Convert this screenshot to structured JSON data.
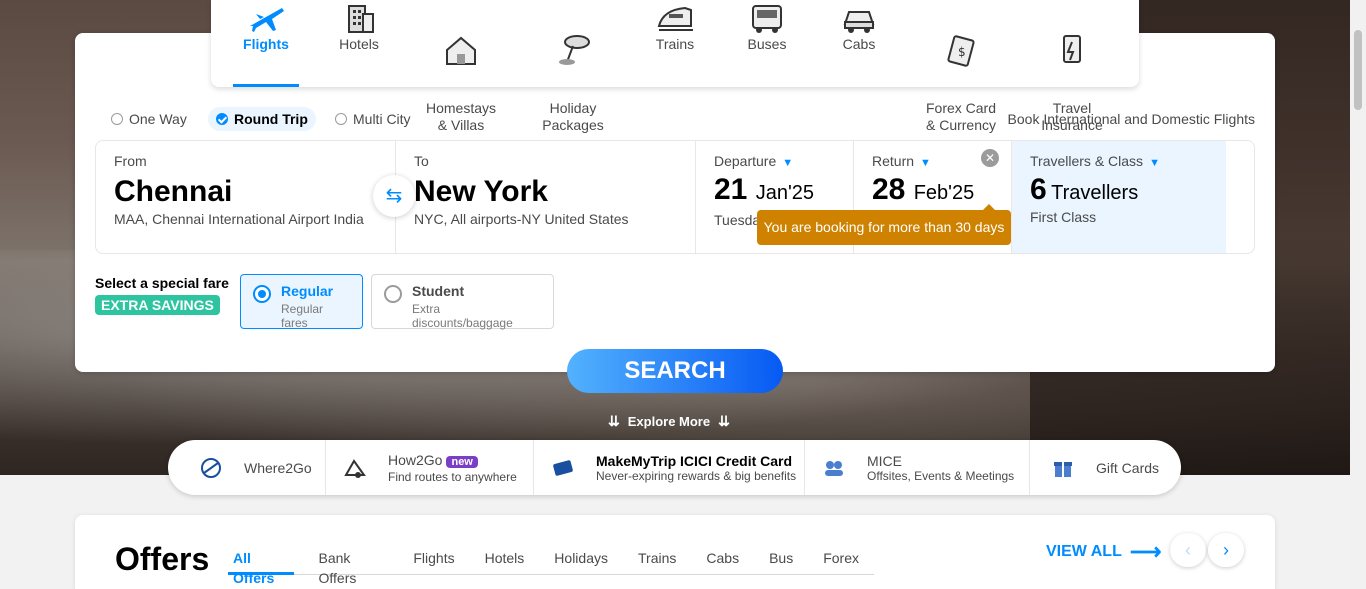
{
  "nav": {
    "items": [
      {
        "label": "Flights",
        "icon": "plane-icon",
        "active": true
      },
      {
        "label": "Hotels",
        "icon": "hotel-icon"
      },
      {
        "label": "Homestays\n& Villas",
        "icon": "homestay-icon"
      },
      {
        "label": "Holiday\nPackages",
        "icon": "holiday-icon"
      },
      {
        "label": "Trains",
        "icon": "train-icon"
      },
      {
        "label": "Buses",
        "icon": "bus-icon"
      },
      {
        "label": "Cabs",
        "icon": "cab-icon"
      },
      {
        "label": "Forex Card\n& Currency",
        "icon": "forex-icon"
      },
      {
        "label": "Travel\nInsurance",
        "icon": "insurance-icon"
      }
    ]
  },
  "trip": {
    "one_way": "One Way",
    "round_trip": "Round Trip",
    "multi_city": "Multi City",
    "tagline": "Book International and Domestic Flights"
  },
  "search": {
    "from_label": "From",
    "from_city": "Chennai",
    "from_airport": "MAA, Chennai International Airport India",
    "to_label": "To",
    "to_city": "New York",
    "to_airport": "NYC, All airports-NY United States",
    "departure_label": "Departure",
    "departure_day": "21",
    "departure_month": "Jan'25",
    "departure_weekday": "Tuesday",
    "return_label": "Return",
    "return_day": "28",
    "return_month": "Feb'25",
    "travellers_label": "Travellers & Class",
    "travellers_count": "6",
    "travellers_word": "Travellers",
    "class": "First Class",
    "tooltip": "You are booking for more than 30 days"
  },
  "fare": {
    "title": "Select a special fare",
    "badge": "EXTRA SAVINGS",
    "options": [
      {
        "title": "Regular",
        "sub": "Regular fares",
        "selected": true
      },
      {
        "title": "Student",
        "sub": "Extra discounts/baggage",
        "selected": false
      }
    ]
  },
  "search_button": "SEARCH",
  "explore": "Explore More",
  "quick_links": [
    {
      "title": "Where2Go",
      "icon": "where2go-icon"
    },
    {
      "title": "How2Go",
      "badge": "new",
      "sub": "Find routes to anywhere",
      "icon": "how2go-icon"
    },
    {
      "title": "MakeMyTrip ICICI Credit Card",
      "sub": "Never-expiring rewards & big benefits",
      "icon": "credit-card-icon"
    },
    {
      "title": "MICE",
      "sub": "Offsites, Events & Meetings",
      "icon": "mice-icon"
    },
    {
      "title": "Gift Cards",
      "icon": "gift-icon"
    }
  ],
  "offers": {
    "title": "Offers",
    "tabs": [
      "All Offers",
      "Bank Offers",
      "Flights",
      "Hotels",
      "Holidays",
      "Trains",
      "Cabs",
      "Bus",
      "Forex"
    ],
    "view_all": "VIEW ALL"
  },
  "colors": {
    "accent": "#008cff",
    "tooltip": "#cf8100",
    "badge": "#2ec4a0"
  }
}
